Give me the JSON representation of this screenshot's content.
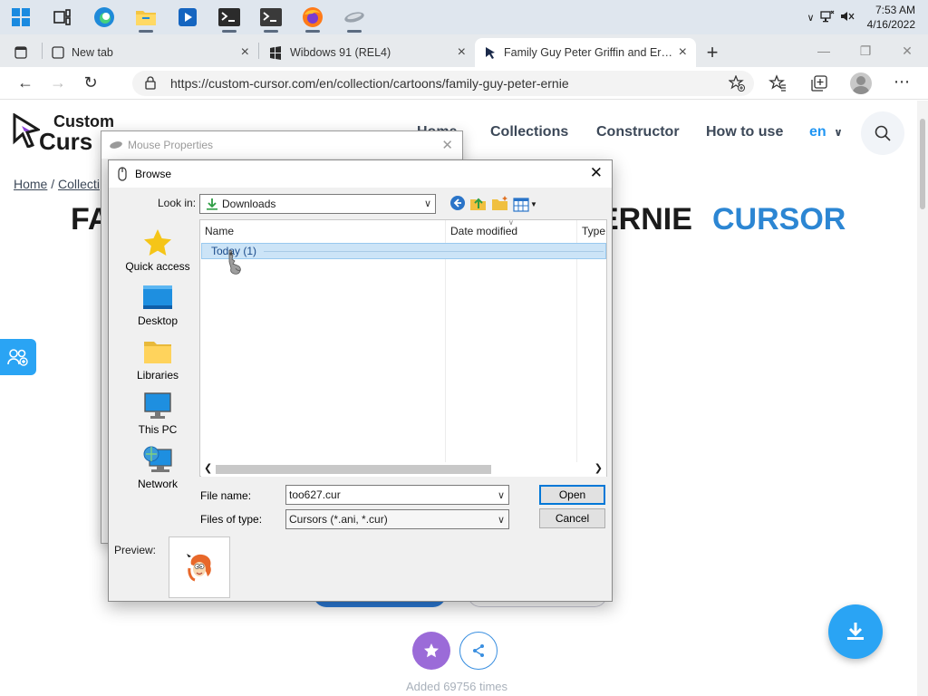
{
  "taskbar": {
    "apps": [
      {
        "icon": "windows-start-icon"
      },
      {
        "icon": "task-view-icon"
      },
      {
        "icon": "edge-icon"
      },
      {
        "icon": "file-explorer-icon"
      },
      {
        "icon": "media-player-icon"
      },
      {
        "icon": "terminal-icon"
      },
      {
        "icon": "terminal-admin-icon"
      },
      {
        "icon": "firefox-icon"
      },
      {
        "icon": "mouse-icon"
      }
    ],
    "time": "7:53 AM",
    "date": "4/16/2022"
  },
  "browser": {
    "tabs": [
      {
        "title": "New tab",
        "close": "×"
      },
      {
        "title": "Wibdows 91 (REL4)",
        "close": "×"
      },
      {
        "title": "Family Guy Peter Griffin and Ernie",
        "close": "×"
      }
    ],
    "new_tab": "+",
    "url": "https://custom-cursor.com/en/collection/cartoons/family-guy-peter-ernie"
  },
  "site": {
    "logo_line1": "Custom",
    "logo_line2": "Curs",
    "nav": {
      "home": "Home",
      "collections": "Collections",
      "constructor": "Constructor",
      "how_to_use": "How to use",
      "lang": "en"
    },
    "breadcrumb": {
      "home": "Home",
      "sep": "/",
      "collections": "Collecti"
    },
    "title_left": "FA",
    "title_right": "ERNIE",
    "title_accent": "CURSOR",
    "added_text": "Added 69756 times",
    "accent_color": "#2aa4f4"
  },
  "mouse_properties": {
    "title": "Mouse Properties",
    "close": "✕"
  },
  "browse": {
    "title": "Browse",
    "close": "✕",
    "look_in_label": "Look in:",
    "look_in_value": "Downloads",
    "places": [
      {
        "label": "Quick access",
        "icon": "star-icon"
      },
      {
        "label": "Desktop",
        "icon": "desktop-icon"
      },
      {
        "label": "Libraries",
        "icon": "libraries-icon"
      },
      {
        "label": "This PC",
        "icon": "this-pc-icon"
      },
      {
        "label": "Network",
        "icon": "network-icon"
      }
    ],
    "columns": {
      "name": "Name",
      "date_modified": "Date modified",
      "type": "Type"
    },
    "group": "Today (1)",
    "file_name_label": "File name:",
    "file_name_value": "too627.cur",
    "files_of_type_label": "Files of type:",
    "files_of_type_value": "Cursors (*.ani, *.cur)",
    "open_button": "Open",
    "cancel_button": "Cancel",
    "preview_label": "Preview:"
  }
}
